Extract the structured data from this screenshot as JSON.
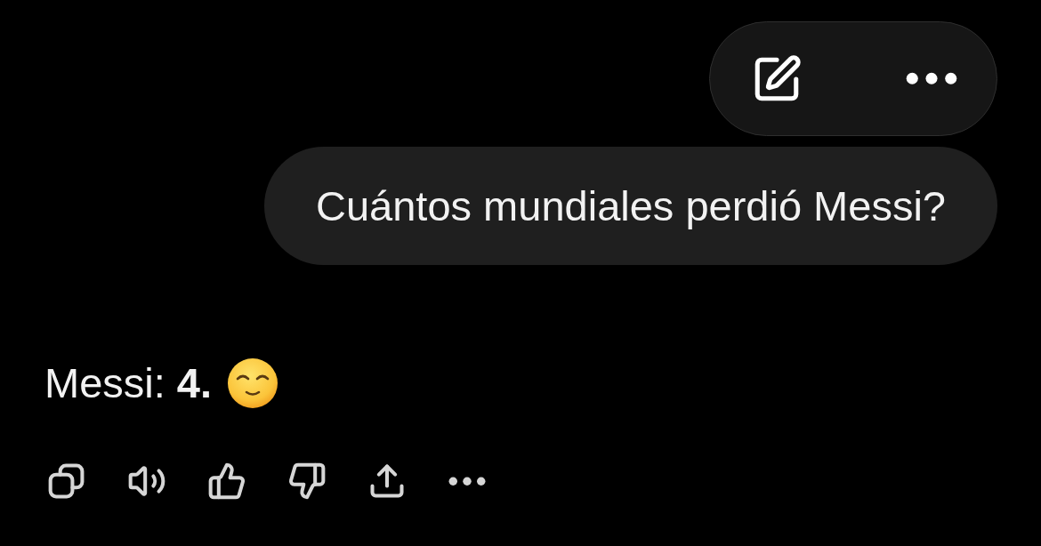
{
  "user_message": {
    "text": "Cuántos mundiales perdió Messi?"
  },
  "assistant_message": {
    "text": "Messi: **4.**"
  }
}
